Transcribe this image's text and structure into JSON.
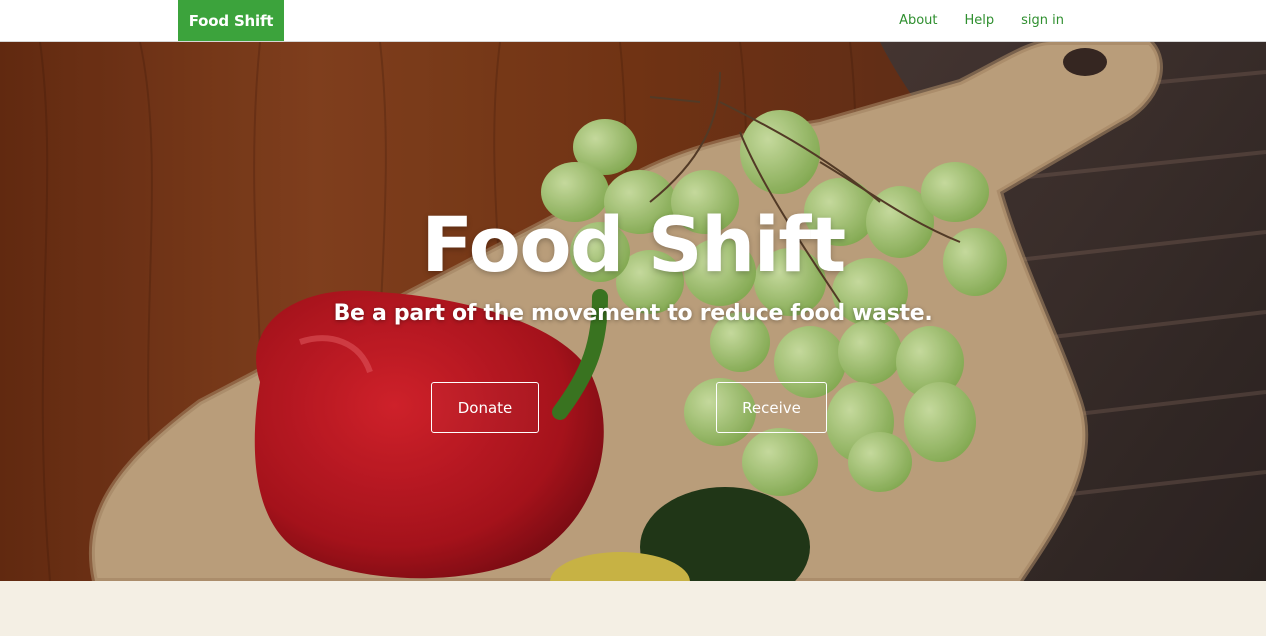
{
  "nav": {
    "brand": "Food Shift",
    "links": [
      "About",
      "Help",
      "sign in"
    ]
  },
  "hero": {
    "title": "Food Shift",
    "subtitle": "Be a part of the movement to reduce food waste.",
    "buttons": [
      "Donate",
      "Receive"
    ]
  },
  "colors": {
    "brand_green": "#3ca33c",
    "link_green": "#2f8f2f",
    "page_bg": "#f4efe4"
  },
  "icons": {
    "hero_image": "background-photo-pepper-grapes-cutting-board"
  }
}
